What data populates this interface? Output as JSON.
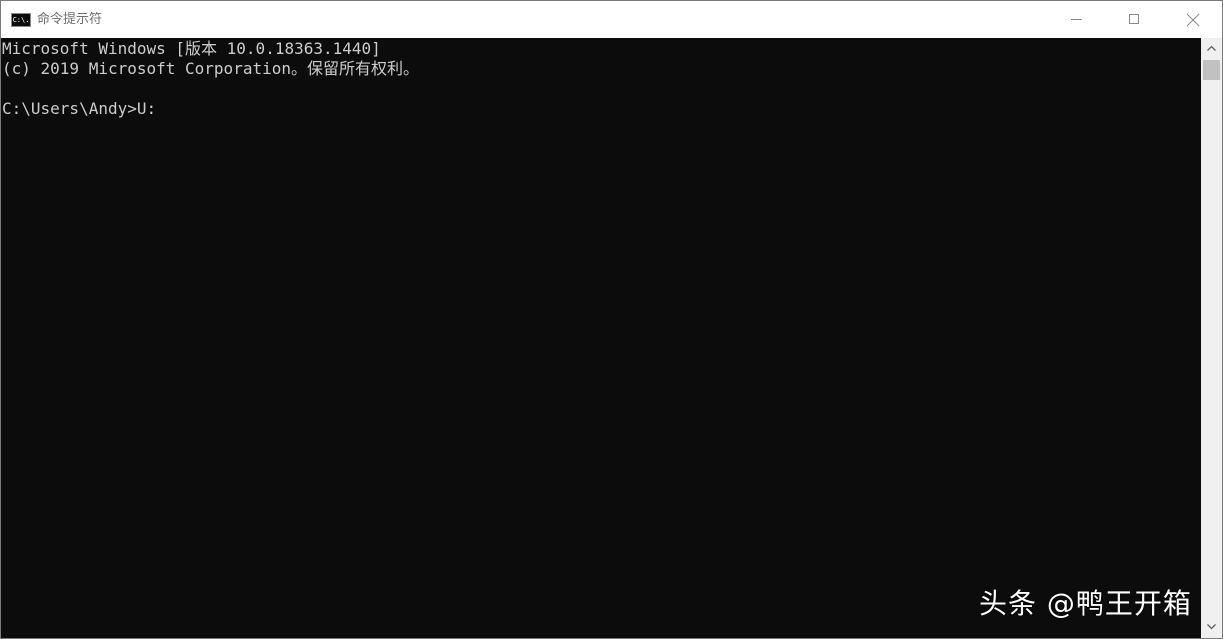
{
  "window": {
    "title": "命令提示符",
    "icon_label": "C:\\."
  },
  "console": {
    "lines": [
      "Microsoft Windows [版本 10.0.18363.1440]",
      "(c) 2019 Microsoft Corporation。保留所有权利。",
      "C:\\Users\\Andy>U:"
    ]
  },
  "watermark": {
    "text": "头条 @鸭王开箱"
  },
  "icons": {
    "app": "cmd-icon",
    "minimize": "minimize-icon",
    "maximize": "maximize-icon",
    "close": "close-icon",
    "scroll_up": "chevron-up-icon",
    "scroll_down": "chevron-down-icon"
  },
  "colors": {
    "console_bg": "#0c0c0c",
    "console_text": "#cccccc",
    "title_text": "#6f6f6f",
    "scrollbar_track": "#f0f0f0",
    "scrollbar_thumb": "#c1c1c1"
  }
}
